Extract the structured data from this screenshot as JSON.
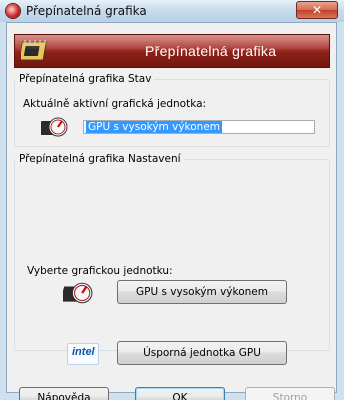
{
  "window": {
    "title": "Přepínatelná grafika",
    "close_glyph": "✕"
  },
  "banner": {
    "title": "Přepínatelná grafika"
  },
  "status_group": {
    "legend": "Přepínatelná grafika Stav",
    "active_label": "Aktuálně aktivní grafická jednotka:",
    "active_value": "GPU s vysokým výkonem"
  },
  "settings_group": {
    "legend": "Přepínatelná grafika Nastavení",
    "choose_label": "Vyberte grafickou jednotku:",
    "high_perf_button": "GPU s vysokým výkonem",
    "power_saving_button": "Úsporná jednotka GPU"
  },
  "icons": {
    "app": "switchable-graphics-app-icon",
    "banner": "graphics-chip-icon",
    "high_perf": "high-performance-gauge-icon",
    "intel": "intel-logo-icon",
    "intel_text": "intel"
  },
  "footer": {
    "help_button": "Nápověda",
    "ok_button": "OK",
    "cancel_button": "Storno"
  },
  "colors": {
    "banner": "#8b2119",
    "selection": "#3399ff",
    "title_bar": "#c9dcec"
  }
}
